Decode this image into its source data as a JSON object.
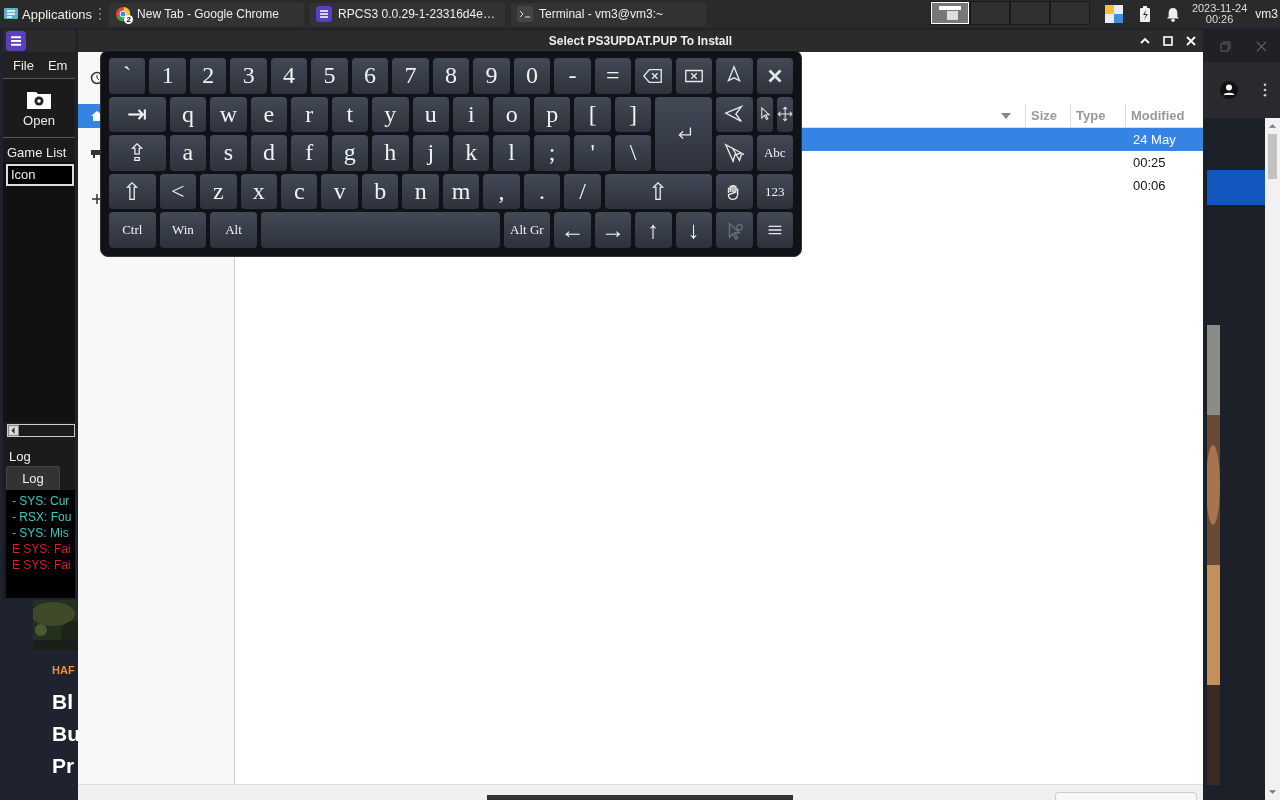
{
  "panel": {
    "launcher": "Applications",
    "tasks": [
      {
        "title": "New Tab - Google Chrome",
        "kind": "browser",
        "badge": "2",
        "selected": false
      },
      {
        "title": "RPCS3 0.0.29-1-23316d4e…",
        "kind": "emulator",
        "selected": false
      },
      {
        "title": "Terminal - vm3@vm3:~",
        "kind": "terminal",
        "selected": false
      }
    ],
    "workspaces": [
      {
        "selected": true
      },
      {
        "selected": false
      },
      {
        "selected": false
      },
      {
        "selected": false
      }
    ],
    "clock": {
      "date": "2023-11-24",
      "time": "00:26"
    },
    "user": "vm3"
  },
  "main_window": {
    "menu": [
      "File",
      "Em"
    ],
    "toolbar": [
      "Open"
    ],
    "game_list_label": "Game List",
    "columns": [
      "Icon"
    ],
    "log_label": "Log",
    "log_tabs": [
      {
        "label": "Log",
        "selected": true
      }
    ],
    "log_lines": [
      {
        "text": "- SYS: Cur",
        "color": "#3fc9c1"
      },
      {
        "text": "- RSX: Fou",
        "color": "#3fc9c1"
      },
      {
        "text": "- SYS: Mis",
        "color": "#3fc9c1"
      },
      {
        "text": "E SYS: Fai",
        "color": "#d3202c"
      },
      {
        "text": "E SYS: Fai",
        "color": "#d3202c"
      }
    ]
  },
  "browser_page": {
    "lines": [
      {
        "text": "HAF",
        "kind": "kicker"
      },
      {
        "text": "Bl",
        "kind": "headline"
      },
      {
        "text": "Bu",
        "kind": "headline"
      },
      {
        "text": "Pr",
        "kind": "headline"
      }
    ]
  },
  "dialog": {
    "title": "Select PS3UPDAT.PUP To Install",
    "places": [
      {
        "kind": "recent",
        "selected": false
      },
      {
        "kind": "home",
        "selected": true
      },
      {
        "kind": "drive",
        "selected": false
      },
      {
        "kind": "add",
        "selected": false
      }
    ],
    "columns": [
      "Size",
      "Type",
      "Modified"
    ],
    "rows": [
      {
        "modified": "24 May",
        "selected": true
      },
      {
        "modified": "00:25",
        "selected": false
      },
      {
        "modified": "00:06",
        "selected": false
      }
    ]
  },
  "keyboard": {
    "rows": [
      [
        {
          "kind": "char",
          "label": "`"
        },
        {
          "kind": "char",
          "label": "1"
        },
        {
          "kind": "char",
          "label": "2"
        },
        {
          "kind": "char",
          "label": "3"
        },
        {
          "kind": "char",
          "label": "4"
        },
        {
          "kind": "char",
          "label": "5"
        },
        {
          "kind": "char",
          "label": "6"
        },
        {
          "kind": "char",
          "label": "7"
        },
        {
          "kind": "char",
          "label": "8"
        },
        {
          "kind": "char",
          "label": "9"
        },
        {
          "kind": "char",
          "label": "0"
        },
        {
          "kind": "char",
          "label": "-"
        },
        {
          "kind": "char",
          "label": "="
        },
        {
          "kind": "backspace"
        },
        {
          "kind": "delete"
        },
        {
          "kind": "cursorup"
        },
        {
          "kind": "close"
        }
      ],
      [
        {
          "kind": "tab",
          "label": "⇥"
        },
        {
          "kind": "char",
          "label": "q"
        },
        {
          "kind": "char",
          "label": "w"
        },
        {
          "kind": "char",
          "label": "e"
        },
        {
          "kind": "char",
          "label": "r"
        },
        {
          "kind": "char",
          "label": "t"
        },
        {
          "kind": "char",
          "label": "y"
        },
        {
          "kind": "char",
          "label": "u"
        },
        {
          "kind": "char",
          "label": "i"
        },
        {
          "kind": "char",
          "label": "o"
        },
        {
          "kind": "char",
          "label": "p"
        },
        {
          "kind": "char",
          "label": "["
        },
        {
          "kind": "char",
          "label": "]"
        },
        {
          "kind": "enter"
        },
        {
          "kind": "cursorleft"
        },
        {
          "kind": "cursor"
        },
        {
          "kind": "move"
        }
      ],
      [
        {
          "kind": "caps",
          "label": "⇪"
        },
        {
          "kind": "char",
          "label": "a"
        },
        {
          "kind": "char",
          "label": "s"
        },
        {
          "kind": "char",
          "label": "d"
        },
        {
          "kind": "char",
          "label": "f"
        },
        {
          "kind": "char",
          "label": "g"
        },
        {
          "kind": "char",
          "label": "h"
        },
        {
          "kind": "char",
          "label": "j"
        },
        {
          "kind": "char",
          "label": "k"
        },
        {
          "kind": "char",
          "label": "l"
        },
        {
          "kind": "char",
          "label": ";"
        },
        {
          "kind": "char",
          "label": "'"
        },
        {
          "kind": "char",
          "label": "\\"
        },
        {
          "kind": "multicursor"
        },
        {
          "kind": "mode",
          "label": "Abc"
        }
      ],
      [
        {
          "kind": "lshift",
          "label": "⇧"
        },
        {
          "kind": "char",
          "label": "<"
        },
        {
          "kind": "char",
          "label": "z"
        },
        {
          "kind": "char",
          "label": "x"
        },
        {
          "kind": "char",
          "label": "c"
        },
        {
          "kind": "char",
          "label": "v"
        },
        {
          "kind": "char",
          "label": "b"
        },
        {
          "kind": "char",
          "label": "n"
        },
        {
          "kind": "char",
          "label": "m"
        },
        {
          "kind": "char",
          "label": ","
        },
        {
          "kind": "char",
          "label": "."
        },
        {
          "kind": "char",
          "label": "/"
        },
        {
          "kind": "rshift",
          "label": "⇧"
        },
        {
          "kind": "hand"
        },
        {
          "kind": "mode",
          "label": "123"
        }
      ],
      [
        {
          "kind": "mod",
          "label": "Ctrl"
        },
        {
          "kind": "mod",
          "label": "Win"
        },
        {
          "kind": "mod",
          "label": "Alt"
        },
        {
          "kind": "space"
        },
        {
          "kind": "mod",
          "label": "Alt Gr"
        },
        {
          "kind": "arrow",
          "label": "←"
        },
        {
          "kind": "arrow",
          "label": "→"
        },
        {
          "kind": "arrow",
          "label": "↑"
        },
        {
          "kind": "arrow",
          "label": "↓"
        },
        {
          "kind": "cursorwait"
        },
        {
          "kind": "menu"
        }
      ]
    ]
  }
}
